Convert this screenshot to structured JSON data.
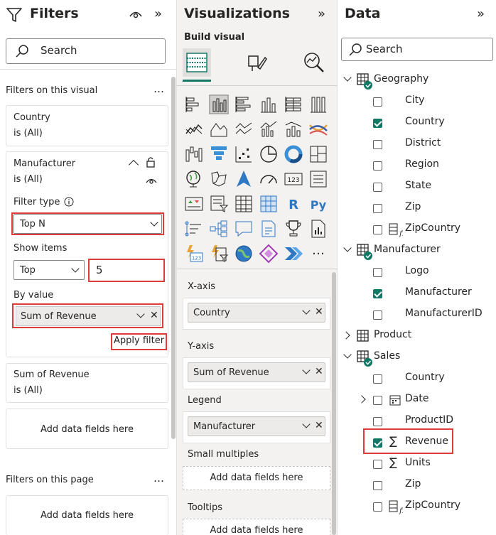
{
  "filters": {
    "title": "Filters",
    "search_placeholder": "Search",
    "on_visual_label": "Filters on this visual",
    "on_page_label": "Filters on this page",
    "country_card": {
      "title": "Country",
      "state": "is (All)"
    },
    "manufacturer_card": {
      "title": "Manufacturer",
      "state": "is (All)",
      "filter_type_label": "Filter type",
      "filter_type_value": "Top N",
      "show_items_label": "Show items",
      "show_items_direction": "Top",
      "show_items_count": "5",
      "by_value_label": "By value",
      "by_value_field": "Sum of Revenue",
      "apply_label": "Apply filter"
    },
    "revenue_card": {
      "title": "Sum of Revenue",
      "state": "is (All)"
    },
    "add_fields": "Add data fields here"
  },
  "viz": {
    "title": "Visualizations",
    "build_visual": "Build visual",
    "wells": [
      {
        "label": "X-axis",
        "field": "Country"
      },
      {
        "label": "Y-axis",
        "field": "Sum of Revenue"
      },
      {
        "label": "Legend",
        "field": "Manufacturer"
      }
    ],
    "small_multiples_label": "Small multiples",
    "tooltips_label": "Tooltips",
    "add_fields": "Add data fields here"
  },
  "data": {
    "title": "Data",
    "search_placeholder": "Search",
    "tables": [
      {
        "name": "Geography",
        "fields": [
          "City",
          "Country",
          "District",
          "Region",
          "State",
          "Zip",
          "ZipCountry"
        ]
      },
      {
        "name": "Manufacturer",
        "fields": [
          "Logo",
          "Manufacturer",
          "ManufacturerID"
        ]
      },
      {
        "name": "Product",
        "fields": []
      },
      {
        "name": "Sales",
        "fields": [
          "Country",
          "Date",
          "ProductID",
          "Revenue",
          "Units",
          "Zip",
          "ZipCountry"
        ]
      }
    ]
  },
  "colors": {
    "accent_green": "#117865",
    "highlight_red": "#e03b3b",
    "pane_gray": "#f3f2f1"
  }
}
